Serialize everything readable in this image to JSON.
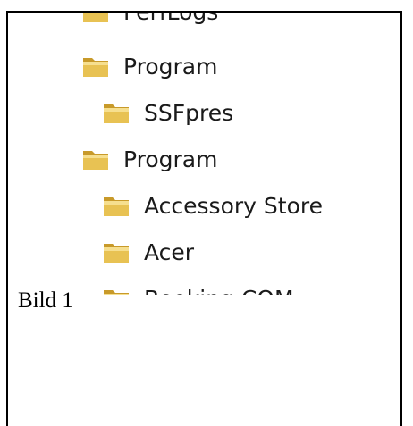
{
  "tree_items": [
    {
      "label": "PerfLogs",
      "level": 0
    },
    {
      "label": "Program",
      "level": 0
    },
    {
      "label": "SSFpres",
      "level": 1
    },
    {
      "label": "Program",
      "level": 0
    },
    {
      "label": "Accessory Store",
      "level": 1
    },
    {
      "label": "Acer",
      "level": 1
    },
    {
      "label": "Booking.COM",
      "level": 1
    }
  ],
  "caption": "Bild 1",
  "colors": {
    "folder_body": "#e8c253",
    "folder_light": "#f6df8f",
    "folder_dark": "#c89a2a"
  }
}
